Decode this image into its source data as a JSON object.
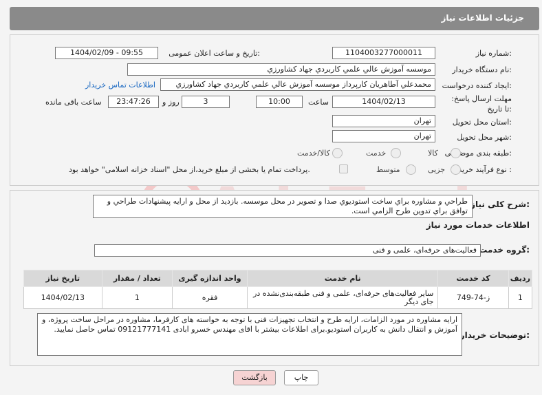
{
  "header": {
    "title": "جزئیات اطلاعات نیاز"
  },
  "form": {
    "need_number": {
      "label": "شماره نیاز:",
      "value": "1104003277000011"
    },
    "announce_datetime": {
      "label": "تاریخ و ساعت اعلان عمومی:",
      "value": "1404/02/09 - 09:55"
    },
    "buyer_org": {
      "label": "نام دستگاه خریدار:",
      "value": "موسسه آموزش عالي علمي كاربردي جهاد كشاورزي"
    },
    "requester": {
      "label": "ایجاد کننده درخواست:",
      "value": "محمدعلي آطاهريان كارپرداز موسسه آموزش عالي علمي كاربردي جهاد كشاورزي",
      "contact_link": "اطلاعات تماس خریدار"
    },
    "deadline": {
      "label": "مهلت ارسال پاسخ: تا تاریخ:",
      "date": "1404/02/13",
      "time_label": "ساعت",
      "time": "10:00",
      "days": "3",
      "days_label": "روز و",
      "remaining": "23:47:26",
      "remaining_label": "ساعت باقی مانده"
    },
    "province": {
      "label": "استان محل تحویل:",
      "value": "تهران"
    },
    "city": {
      "label": "شهر محل تحویل:",
      "value": "تهران"
    },
    "category": {
      "label": "طبقه بندی موضوعی:",
      "options": [
        "کالا",
        "خدمت",
        "کالا/خدمت"
      ]
    },
    "purchase_type": {
      "label": "نوع فرآیند خرید :",
      "options": [
        "جزیی",
        "متوسط"
      ],
      "payment_note": "پرداخت تمام یا بخشی از مبلغ خرید،از محل \"اسناد خزانه اسلامی\" خواهد بود."
    }
  },
  "summary": {
    "label": "شرح کلی نیاز:",
    "text": "طراحي و مشاوره براي ساخت استوديوي صدا و تصوير در محل موسسه. بازديد از محل و ارايه پيشنهادات طراحي و توافق براي تدوين طرح الزامي است."
  },
  "services": {
    "heading": "اطلاعات خدمات مورد نیاز",
    "group_label": "گروه خدمت:",
    "group_value": "فعالیت‌های حرفه‌ای، علمی و فنی",
    "columns": [
      "ردیف",
      "کد خدمت",
      "نام خدمت",
      "واحد اندازه گیری",
      "تعداد / مقدار",
      "تاریخ نیاز"
    ],
    "rows": [
      {
        "row": "1",
        "code": "ز-74-749",
        "name": "سایر فعالیت‌های حرفه‌ای، علمی و فنی طبقه‌بندی‌نشده در جای دیگر",
        "unit": "فقره",
        "qty": "1",
        "date": "1404/02/13"
      }
    ]
  },
  "buyer_notes": {
    "label": "توضیحات خریدار:",
    "text": "ارایه مشاوره در مورد الزامات، ارایه طرح و انتخاب تجهیزات فنی با توجه به خواسته های کارفرما، مشاوره در مراحل ساخت پروژه، و آموزش و انتقال دانش به کاربران استودیو.برای اطلاعات بیشتر با اقای مهندس خسرو ابادی 09121777141 تماس حاصل نمایید."
  },
  "buttons": {
    "print": "چاپ",
    "back": "بازگشت"
  },
  "colors": {
    "header_bg": "#8a8a8a",
    "link": "#1565c0",
    "back_bg": "#f6d3d3"
  }
}
